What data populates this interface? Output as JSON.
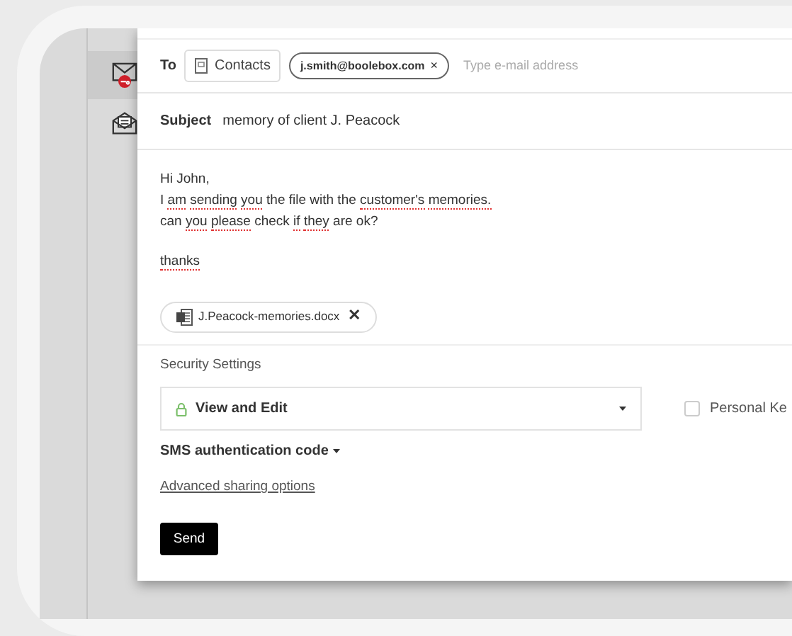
{
  "sidebar": {
    "items": [
      {
        "kind": "secure-mail",
        "selected": true
      },
      {
        "kind": "inbox",
        "selected": false
      }
    ]
  },
  "compose": {
    "to_label": "To",
    "contacts_button": "Contacts",
    "recipients": [
      {
        "email": "j.smith@boolebox.com",
        "remove": "×"
      }
    ],
    "to_placeholder": "Type e-mail address",
    "subject_label": "Subject",
    "subject": "memory of client J. Peacock",
    "body": [
      [
        [
          {
            "text": "Hi John,",
            "misspelled": false
          }
        ],
        [
          {
            "text": "I",
            "misspelled": false
          },
          {
            "text": "am",
            "misspelled": true
          },
          {
            "text": "sending",
            "misspelled": true
          },
          {
            "text": "you",
            "misspelled": true
          },
          {
            "text": "the file with the",
            "misspelled": false
          },
          {
            "text": "customer's",
            "misspelled": true
          },
          {
            "text": "memories.",
            "misspelled": true
          }
        ],
        [
          {
            "text": "can",
            "misspelled": false
          },
          {
            "text": "you",
            "misspelled": true
          },
          {
            "text": "please",
            "misspelled": true
          },
          {
            "text": "check",
            "misspelled": false
          },
          {
            "text": "if",
            "misspelled": true
          },
          {
            "text": "they",
            "misspelled": true
          },
          {
            "text": "are ok?",
            "misspelled": false
          }
        ]
      ],
      [
        [
          {
            "text": "thanks",
            "misspelled": true
          }
        ]
      ]
    ],
    "attachments": [
      {
        "name": "J.Peacock-memories.docx",
        "remove": "✕"
      }
    ],
    "security_label": "Security Settings",
    "permission": "View and Edit",
    "personal_key": {
      "label": "Personal Ke",
      "checked": false
    },
    "sms_toggle": "SMS authentication code",
    "advanced_link": "Advanced sharing options",
    "send_button": "Send"
  }
}
